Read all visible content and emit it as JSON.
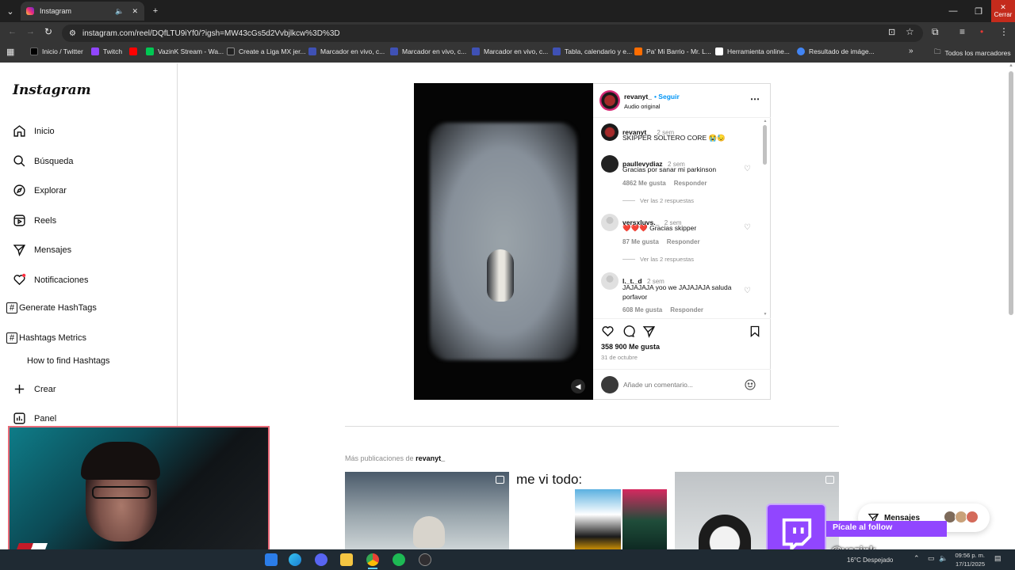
{
  "browser": {
    "tab_title": "Instagram",
    "close_tooltip": "Cerrar",
    "url": "instagram.com/reel/DQfLTU9iYf0/?igsh=MW43cGs5d2Vvbjlkcw%3D%3D",
    "bookmarks": [
      {
        "label": "Inicio / Twitter",
        "color": "#000000"
      },
      {
        "label": "Twitch",
        "color": "#9146ff"
      },
      {
        "label": "",
        "color": "#ff0000"
      },
      {
        "label": "VazinK Stream - Wa...",
        "color": "#00c853"
      },
      {
        "label": "Create a Liga MX jer...",
        "color": "#222222"
      },
      {
        "label": "Marcador en vivo, c...",
        "color": "#3f51b5"
      },
      {
        "label": "Marcador en vivo, c...",
        "color": "#3f51b5"
      },
      {
        "label": "Marcador en vivo, c...",
        "color": "#3f51b5"
      },
      {
        "label": "Tabla, calendario y e...",
        "color": "#3f51b5"
      },
      {
        "label": "Pa' Mi Barrio - Mr. L...",
        "color": "#ff6d00"
      },
      {
        "label": "Herramienta online...",
        "color": "#ffffff"
      },
      {
        "label": "Resultado de imáge...",
        "color": "#4285f4"
      }
    ],
    "all_bookmarks": "Todos los marcadores"
  },
  "instagram": {
    "logo": "Instagram",
    "nav": [
      {
        "label": "Inicio",
        "icon": "home-icon"
      },
      {
        "label": "Búsqueda",
        "icon": "search-icon"
      },
      {
        "label": "Explorar",
        "icon": "compass-icon"
      },
      {
        "label": "Reels",
        "icon": "reels-icon"
      },
      {
        "label": "Mensajes",
        "icon": "messenger-icon"
      },
      {
        "label": "Notificaciones",
        "icon": "heart-icon"
      },
      {
        "label": "Generate HashTags",
        "icon": "hashtag-icon"
      },
      {
        "label": "Hashtags Metrics",
        "icon": "hashtag-icon"
      },
      {
        "label": "How to find Hashtags",
        "icon": ""
      },
      {
        "label": "Crear",
        "icon": "plus-icon"
      },
      {
        "label": "Panel",
        "icon": "chart-icon"
      }
    ],
    "post": {
      "username": "revanyt_",
      "follow": "• Seguir",
      "audio": "Audio original",
      "caption_user": "revanyt_",
      "caption_time": "2 sem",
      "caption_text": "SKIPPER SOLTERO CORE 😭😓",
      "comments": [
        {
          "user": "paullevydiaz",
          "time": "2 sem",
          "text": "Gracias por sanar mi parkinson",
          "likes": "4862 Me gusta",
          "reply": "Responder",
          "replies": "Ver las 2 respuestas"
        },
        {
          "user": "versxluvs._",
          "time": "2 sem",
          "text": "❤️❤️❤️ Gracias skipper",
          "likes": "87 Me gusta",
          "reply": "Responder",
          "replies": "Ver las 2 respuestas"
        },
        {
          "user": "l._t._d",
          "time": "2 sem",
          "text": "JAJAJAJA yoo we JAJAJAJA saluda porfavor",
          "likes": "608 Me gusta",
          "reply": "Responder",
          "replies": ""
        }
      ],
      "like_count": "358 900 Me gusta",
      "date": "31 de octubre",
      "comment_placeholder": "Añade un comentario..."
    },
    "more_posts_prefix": "Más publicaciones de ",
    "more_posts_user": "revanyt_",
    "thumb2_caption": "me vi todo:",
    "messages_pill": "Mensajes"
  },
  "overlay": {
    "follow_text": "Pícale al follow",
    "handle": "@vazink"
  },
  "taskbar": {
    "weather": "16°C  Despejado",
    "time": "09:56 p. m.",
    "date": "17/11/2025"
  }
}
